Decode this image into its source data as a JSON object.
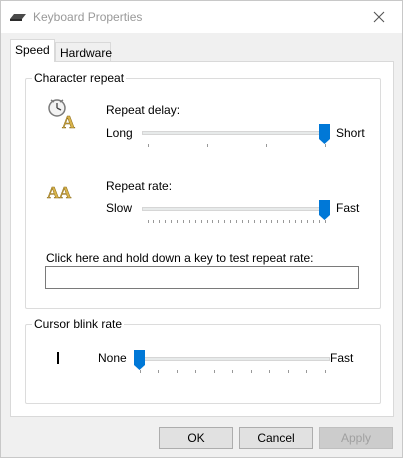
{
  "window": {
    "title": "Keyboard Properties",
    "close_icon": "close-icon",
    "app_icon": "keyboard-icon"
  },
  "tabs": [
    {
      "label": "Speed",
      "selected": true
    },
    {
      "label": "Hardware",
      "selected": false
    }
  ],
  "character_repeat": {
    "group_label": "Character repeat",
    "repeat_delay": {
      "label": "Repeat delay:",
      "icon": "repeat-delay-icon",
      "min_label": "Long",
      "max_label": "Short",
      "value_fraction": 1.0
    },
    "repeat_rate": {
      "label": "Repeat rate:",
      "icon": "repeat-rate-icon",
      "min_label": "Slow",
      "max_label": "Fast",
      "value_fraction": 1.0
    },
    "test": {
      "label": "Click here and hold down a key to test repeat rate:",
      "value": ""
    }
  },
  "cursor_blink": {
    "group_label": "Cursor blink rate",
    "min_label": "None",
    "max_label": "Fast",
    "value_fraction": 0.0
  },
  "buttons": {
    "ok": "OK",
    "cancel": "Cancel",
    "apply": "Apply"
  },
  "colors": {
    "slider_thumb": "#0078d7",
    "title_text": "#999999"
  }
}
